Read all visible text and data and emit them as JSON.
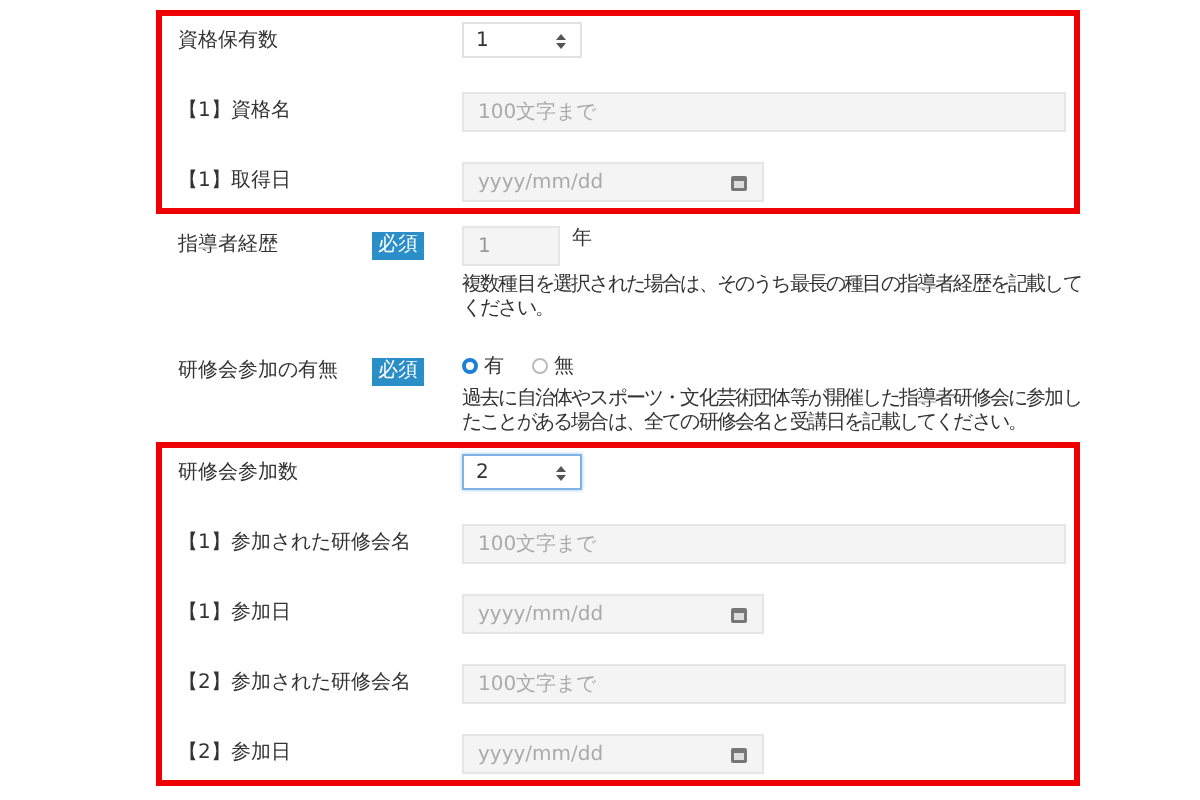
{
  "sections": [
    {
      "highlighted": true,
      "rows": [
        {
          "kind": "select",
          "label": "資格保有数",
          "value": "1",
          "focused": false
        },
        {
          "kind": "text",
          "label": "【1】資格名",
          "placeholder": "100文字まで"
        },
        {
          "kind": "date",
          "label": "【1】取得日",
          "placeholder": "yyyy/mm/dd"
        }
      ]
    },
    {
      "highlighted": false,
      "rows": [
        {
          "kind": "number",
          "label": "指導者経歴",
          "badge": "必須",
          "value": "1",
          "unit": "年",
          "note": "複数種目を選択された場合は、そのうち最長の種目の指導者経歴を記載してください。"
        },
        {
          "kind": "radio",
          "label": "研修会参加の有無",
          "badge": "必須",
          "options": [
            {
              "label": "有",
              "selected": true
            },
            {
              "label": "無",
              "selected": false
            }
          ],
          "note": "過去に自治体やスポーツ・文化芸術団体等が開催した指導者研修会に参加したことがある場合は、全ての研修会名と受講日を記載してください。"
        }
      ]
    },
    {
      "highlighted": true,
      "rows": [
        {
          "kind": "select",
          "label": "研修会参加数",
          "value": "2",
          "focused": true
        },
        {
          "kind": "text",
          "label": "【1】参加された研修会名",
          "placeholder": "100文字まで"
        },
        {
          "kind": "date",
          "label": "【1】参加日",
          "placeholder": "yyyy/mm/dd"
        },
        {
          "kind": "text",
          "label": "【2】参加された研修会名",
          "placeholder": "100文字まで"
        },
        {
          "kind": "date",
          "label": "【2】参加日",
          "placeholder": "yyyy/mm/dd"
        }
      ]
    }
  ]
}
